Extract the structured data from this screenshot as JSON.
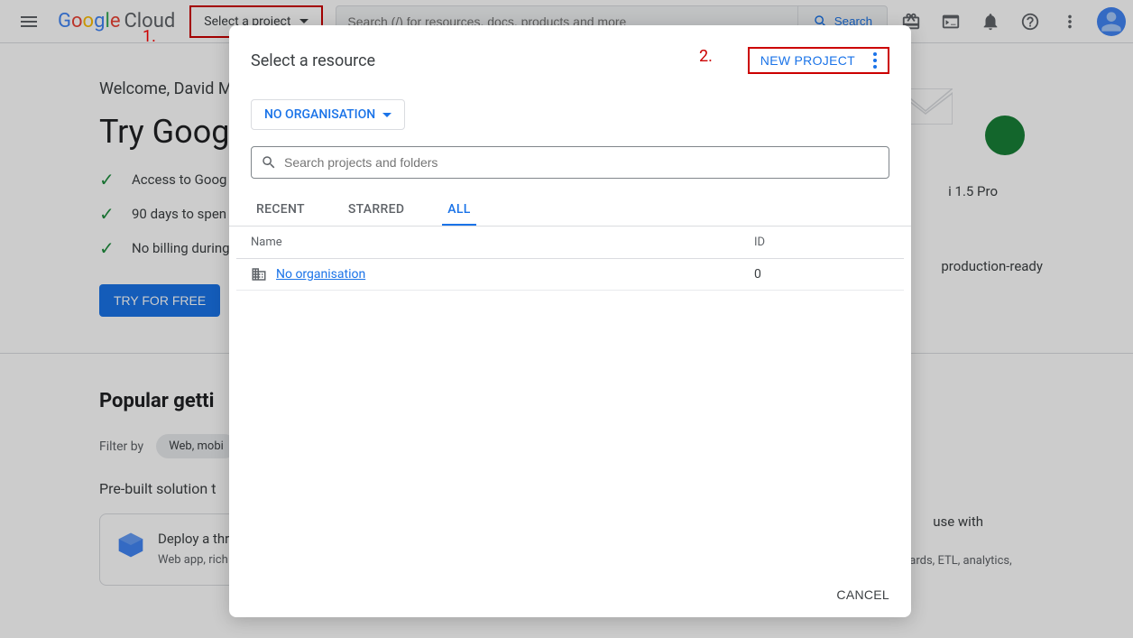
{
  "header": {
    "logo_cloud": "Cloud",
    "project_label": "Select a project",
    "search_placeholder": "Search (/) for resources, docs, products and more",
    "search_btn": "Search"
  },
  "annotations": {
    "one": "1.",
    "two": "2."
  },
  "main": {
    "welcome": "Welcome, David M",
    "try_heading": "Try Googl",
    "features": [
      "Access to Goog",
      "90 days to spen",
      "No billing during"
    ],
    "try_free": "TRY FOR FREE",
    "popular": "Popular getti",
    "filter_by": "Filter by",
    "filter_chip": "Web, mobi",
    "prebuilt": "Pre-built solution t",
    "card_title": "Deploy a thre",
    "card_desc": "Web app, rich m                    \ndatabase-backed            ",
    "gemini": "i 1.5 Pro",
    "ready": "production-ready",
    "use_with": "use with",
    "card_frag": "Data warehouse, dashboards, ETL, analytics, data analysis"
  },
  "modal": {
    "title": "Select a resource",
    "new_project": "NEW PROJECT",
    "org_label": "NO ORGANISATION",
    "search_placeholder": "Search projects and folders",
    "tabs": {
      "recent": "RECENT",
      "starred": "STARRED",
      "all": "ALL"
    },
    "columns": {
      "name": "Name",
      "id": "ID"
    },
    "rows": [
      {
        "name": "No organisation",
        "id": "0"
      }
    ],
    "cancel": "CANCEL"
  }
}
